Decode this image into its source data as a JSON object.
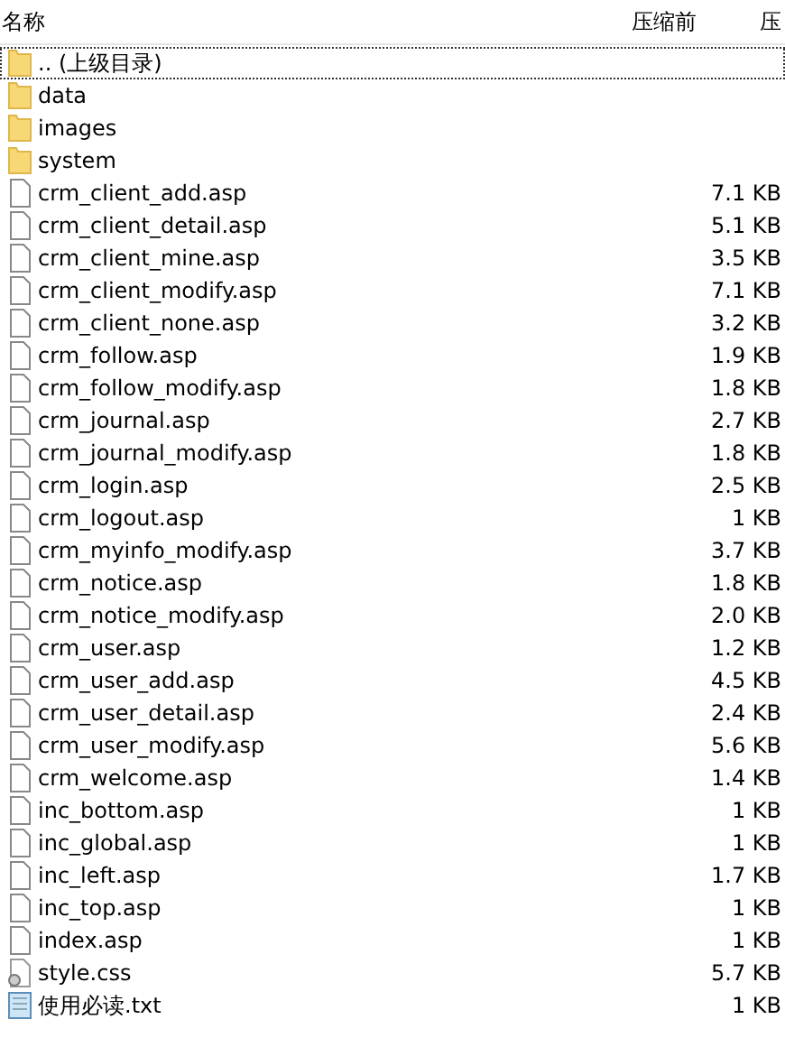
{
  "columns": [
    {
      "label": "名称"
    },
    {
      "label": "压缩前"
    },
    {
      "label": "压"
    }
  ],
  "rows": [
    {
      "kind": "folder",
      "name": ".. (上级目录)",
      "focused": true
    },
    {
      "kind": "folder",
      "name": "data",
      "focused": false
    },
    {
      "kind": "folder",
      "name": "images",
      "focused": false
    },
    {
      "kind": "folder",
      "name": "system",
      "focused": false
    },
    {
      "kind": "file",
      "name": "crm_client_add.asp",
      "size": "7.1 KB",
      "focused": false
    },
    {
      "kind": "file",
      "name": "crm_client_detail.asp",
      "size": "5.1 KB",
      "focused": false
    },
    {
      "kind": "file",
      "name": "crm_client_mine.asp",
      "size": "3.5 KB",
      "focused": false
    },
    {
      "kind": "file",
      "name": "crm_client_modify.asp",
      "size": "7.1 KB",
      "focused": false
    },
    {
      "kind": "file",
      "name": "crm_client_none.asp",
      "size": "3.2 KB",
      "focused": false
    },
    {
      "kind": "file",
      "name": "crm_follow.asp",
      "size": "1.9 KB",
      "focused": false
    },
    {
      "kind": "file",
      "name": "crm_follow_modify.asp",
      "size": "1.8 KB",
      "focused": false
    },
    {
      "kind": "file",
      "name": "crm_journal.asp",
      "size": "2.7 KB",
      "focused": false
    },
    {
      "kind": "file",
      "name": "crm_journal_modify.asp",
      "size": "1.8 KB",
      "focused": false
    },
    {
      "kind": "file",
      "name": "crm_login.asp",
      "size": "2.5 KB",
      "focused": false
    },
    {
      "kind": "file",
      "name": "crm_logout.asp",
      "size": "1 KB",
      "focused": false
    },
    {
      "kind": "file",
      "name": "crm_myinfo_modify.asp",
      "size": "3.7 KB",
      "focused": false
    },
    {
      "kind": "file",
      "name": "crm_notice.asp",
      "size": "1.8 KB",
      "focused": false
    },
    {
      "kind": "file",
      "name": "crm_notice_modify.asp",
      "size": "2.0 KB",
      "focused": false
    },
    {
      "kind": "file",
      "name": "crm_user.asp",
      "size": "1.2 KB",
      "focused": false
    },
    {
      "kind": "file",
      "name": "crm_user_add.asp",
      "size": "4.5 KB",
      "focused": false
    },
    {
      "kind": "file",
      "name": "crm_user_detail.asp",
      "size": "2.4 KB",
      "focused": false
    },
    {
      "kind": "file",
      "name": "crm_user_modify.asp",
      "size": "5.6 KB",
      "focused": false
    },
    {
      "kind": "file",
      "name": "crm_welcome.asp",
      "size": "1.4 KB",
      "focused": false
    },
    {
      "kind": "file",
      "name": "inc_bottom.asp",
      "size": "1 KB",
      "focused": false
    },
    {
      "kind": "file",
      "name": "inc_global.asp",
      "size": "1 KB",
      "focused": false
    },
    {
      "kind": "file",
      "name": "inc_left.asp",
      "size": "1.7 KB",
      "focused": false
    },
    {
      "kind": "file",
      "name": "inc_top.asp",
      "size": "1 KB",
      "focused": false
    },
    {
      "kind": "file",
      "name": "index.asp",
      "size": "1 KB",
      "focused": false
    },
    {
      "kind": "css",
      "name": "style.css",
      "size": "5.7 KB",
      "focused": false
    },
    {
      "kind": "txt",
      "name": "使用必读.txt",
      "size": "1 KB",
      "focused": false
    }
  ]
}
